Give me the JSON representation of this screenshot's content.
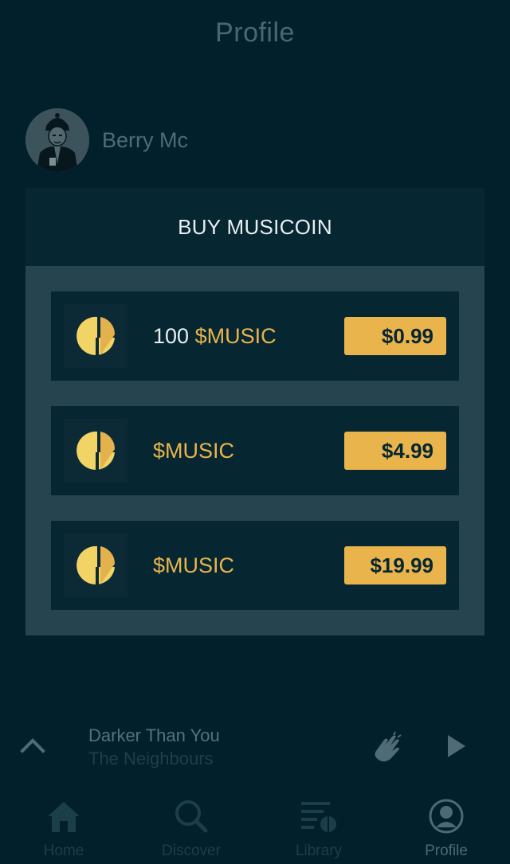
{
  "header": {
    "title": "Profile"
  },
  "profile": {
    "username": "Berry Mc"
  },
  "buy_section": {
    "title": "BUY MUSICOIN",
    "packages": [
      {
        "amount": "100",
        "currency": "$MUSIC",
        "price": "$0.99"
      },
      {
        "amount": "",
        "currency": "$MUSIC",
        "price": "$4.99"
      },
      {
        "amount": "",
        "currency": "$MUSIC",
        "price": "$19.99"
      }
    ]
  },
  "player": {
    "track_title": "Darker Than You",
    "artist": "The Neighbours"
  },
  "tabs": [
    {
      "label": "Home",
      "icon": "home-icon",
      "active": false
    },
    {
      "label": "Discover",
      "icon": "search-icon",
      "active": false
    },
    {
      "label": "Library",
      "icon": "library-icon",
      "active": false
    },
    {
      "label": "Profile",
      "icon": "profile-icon",
      "active": true
    }
  ],
  "colors": {
    "background": "#02202c",
    "accent": "#e9b44c",
    "panel": "#25444f",
    "card": "#062632"
  }
}
